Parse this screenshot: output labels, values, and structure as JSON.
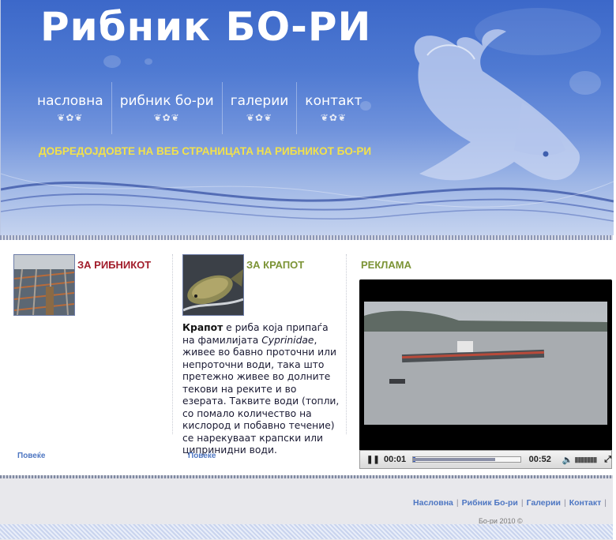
{
  "header": {
    "site_title": "Рибник БО-РИ",
    "welcome": "ДОБРЕДОЈДОВТЕ НА ВЕБ СТРАНИЦАТА НА РИБНИКОТ БО-РИ"
  },
  "nav": {
    "items": [
      {
        "label": "насловна"
      },
      {
        "label": "рибник бо-ри"
      },
      {
        "label": "галерии"
      },
      {
        "label": "контакт"
      }
    ]
  },
  "columns": {
    "about": {
      "title": "ЗА РИБНИКОТ",
      "more": "Повеќе",
      "title_color": "#a11c2a"
    },
    "carp": {
      "title": "ЗА КРАПОТ",
      "more": "Повеќе",
      "title_color": "#7c9436",
      "lead": "Крапот",
      "text_a": " е риба која припаѓа на фамилијата ",
      "family": "Cyprinidae",
      "text_b": ", живее во бавно проточни или непроточни води, така што претежно живее во долните текови на реките и во езерата. Таквите води (топли, со помало количество на кислород и побавно течение) се нарекуваат крапски или ципринидни води."
    },
    "ad": {
      "title": "РЕКЛАМА",
      "title_color": "#7c9436"
    }
  },
  "video": {
    "current_time": "00:01",
    "duration": "00:52",
    "progress": 0.02
  },
  "footer": {
    "links": [
      "Насловна",
      "Рибник Бо-ри",
      "Галерии",
      "Контакт"
    ],
    "copyright": "Бо-ри 2010 ©"
  },
  "colors": {
    "link": "#4d76c2",
    "header_blue": "#4f7ad2",
    "welcome_yellow": "#f2e14b"
  }
}
